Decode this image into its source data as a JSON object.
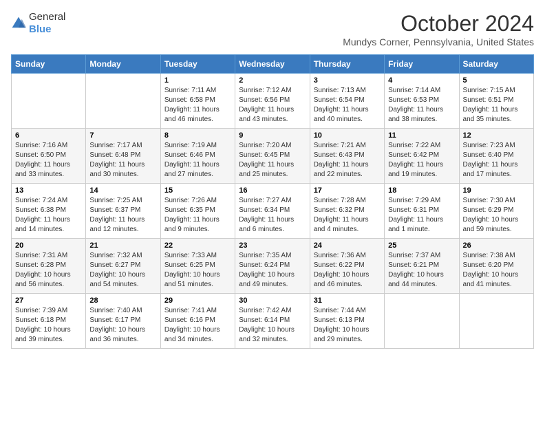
{
  "header": {
    "logo_general": "General",
    "logo_blue": "Blue",
    "month": "October 2024",
    "location": "Mundys Corner, Pennsylvania, United States"
  },
  "days_of_week": [
    "Sunday",
    "Monday",
    "Tuesday",
    "Wednesday",
    "Thursday",
    "Friday",
    "Saturday"
  ],
  "weeks": [
    [
      {
        "day": "",
        "info": ""
      },
      {
        "day": "",
        "info": ""
      },
      {
        "day": "1",
        "info": "Sunrise: 7:11 AM\nSunset: 6:58 PM\nDaylight: 11 hours and 46 minutes."
      },
      {
        "day": "2",
        "info": "Sunrise: 7:12 AM\nSunset: 6:56 PM\nDaylight: 11 hours and 43 minutes."
      },
      {
        "day": "3",
        "info": "Sunrise: 7:13 AM\nSunset: 6:54 PM\nDaylight: 11 hours and 40 minutes."
      },
      {
        "day": "4",
        "info": "Sunrise: 7:14 AM\nSunset: 6:53 PM\nDaylight: 11 hours and 38 minutes."
      },
      {
        "day": "5",
        "info": "Sunrise: 7:15 AM\nSunset: 6:51 PM\nDaylight: 11 hours and 35 minutes."
      }
    ],
    [
      {
        "day": "6",
        "info": "Sunrise: 7:16 AM\nSunset: 6:50 PM\nDaylight: 11 hours and 33 minutes."
      },
      {
        "day": "7",
        "info": "Sunrise: 7:17 AM\nSunset: 6:48 PM\nDaylight: 11 hours and 30 minutes."
      },
      {
        "day": "8",
        "info": "Sunrise: 7:19 AM\nSunset: 6:46 PM\nDaylight: 11 hours and 27 minutes."
      },
      {
        "day": "9",
        "info": "Sunrise: 7:20 AM\nSunset: 6:45 PM\nDaylight: 11 hours and 25 minutes."
      },
      {
        "day": "10",
        "info": "Sunrise: 7:21 AM\nSunset: 6:43 PM\nDaylight: 11 hours and 22 minutes."
      },
      {
        "day": "11",
        "info": "Sunrise: 7:22 AM\nSunset: 6:42 PM\nDaylight: 11 hours and 19 minutes."
      },
      {
        "day": "12",
        "info": "Sunrise: 7:23 AM\nSunset: 6:40 PM\nDaylight: 11 hours and 17 minutes."
      }
    ],
    [
      {
        "day": "13",
        "info": "Sunrise: 7:24 AM\nSunset: 6:38 PM\nDaylight: 11 hours and 14 minutes."
      },
      {
        "day": "14",
        "info": "Sunrise: 7:25 AM\nSunset: 6:37 PM\nDaylight: 11 hours and 12 minutes."
      },
      {
        "day": "15",
        "info": "Sunrise: 7:26 AM\nSunset: 6:35 PM\nDaylight: 11 hours and 9 minutes."
      },
      {
        "day": "16",
        "info": "Sunrise: 7:27 AM\nSunset: 6:34 PM\nDaylight: 11 hours and 6 minutes."
      },
      {
        "day": "17",
        "info": "Sunrise: 7:28 AM\nSunset: 6:32 PM\nDaylight: 11 hours and 4 minutes."
      },
      {
        "day": "18",
        "info": "Sunrise: 7:29 AM\nSunset: 6:31 PM\nDaylight: 11 hours and 1 minute."
      },
      {
        "day": "19",
        "info": "Sunrise: 7:30 AM\nSunset: 6:29 PM\nDaylight: 10 hours and 59 minutes."
      }
    ],
    [
      {
        "day": "20",
        "info": "Sunrise: 7:31 AM\nSunset: 6:28 PM\nDaylight: 10 hours and 56 minutes."
      },
      {
        "day": "21",
        "info": "Sunrise: 7:32 AM\nSunset: 6:27 PM\nDaylight: 10 hours and 54 minutes."
      },
      {
        "day": "22",
        "info": "Sunrise: 7:33 AM\nSunset: 6:25 PM\nDaylight: 10 hours and 51 minutes."
      },
      {
        "day": "23",
        "info": "Sunrise: 7:35 AM\nSunset: 6:24 PM\nDaylight: 10 hours and 49 minutes."
      },
      {
        "day": "24",
        "info": "Sunrise: 7:36 AM\nSunset: 6:22 PM\nDaylight: 10 hours and 46 minutes."
      },
      {
        "day": "25",
        "info": "Sunrise: 7:37 AM\nSunset: 6:21 PM\nDaylight: 10 hours and 44 minutes."
      },
      {
        "day": "26",
        "info": "Sunrise: 7:38 AM\nSunset: 6:20 PM\nDaylight: 10 hours and 41 minutes."
      }
    ],
    [
      {
        "day": "27",
        "info": "Sunrise: 7:39 AM\nSunset: 6:18 PM\nDaylight: 10 hours and 39 minutes."
      },
      {
        "day": "28",
        "info": "Sunrise: 7:40 AM\nSunset: 6:17 PM\nDaylight: 10 hours and 36 minutes."
      },
      {
        "day": "29",
        "info": "Sunrise: 7:41 AM\nSunset: 6:16 PM\nDaylight: 10 hours and 34 minutes."
      },
      {
        "day": "30",
        "info": "Sunrise: 7:42 AM\nSunset: 6:14 PM\nDaylight: 10 hours and 32 minutes."
      },
      {
        "day": "31",
        "info": "Sunrise: 7:44 AM\nSunset: 6:13 PM\nDaylight: 10 hours and 29 minutes."
      },
      {
        "day": "",
        "info": ""
      },
      {
        "day": "",
        "info": ""
      }
    ]
  ]
}
